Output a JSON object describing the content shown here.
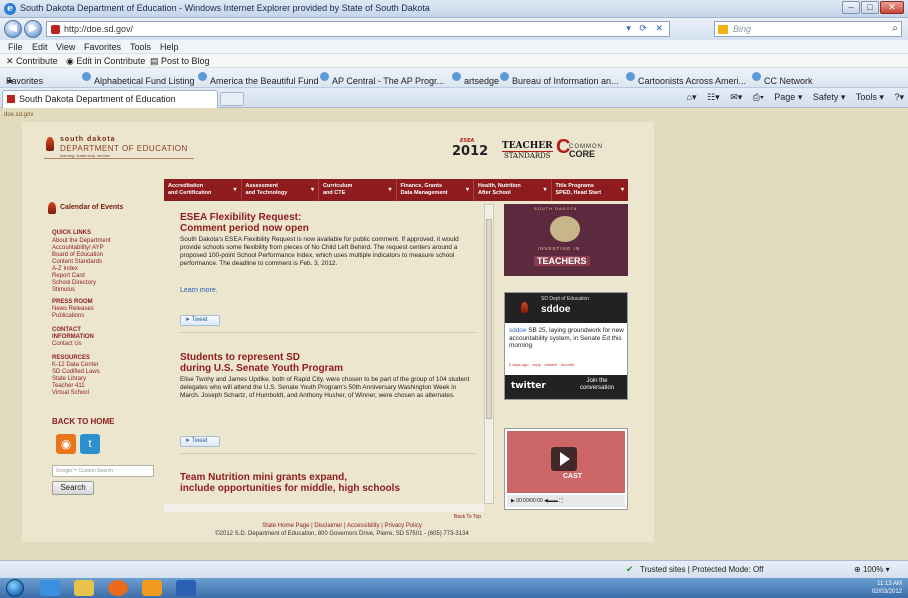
{
  "window": {
    "title": "South Dakota Department of Education - Windows Internet Explorer provided by State of South Dakota",
    "buttons": [
      "–",
      "□",
      "✕"
    ]
  },
  "address_bar": {
    "url": "http://doe.sd.gov/",
    "search_placeholder": "Bing"
  },
  "menu": [
    "File",
    "Edit",
    "View",
    "Favorites",
    "Tools",
    "Help"
  ],
  "contribute": {
    "contribute": "Contribute",
    "edit": "Edit in Contribute",
    "post": "Post to Blog"
  },
  "favorites": {
    "label": "Favorites",
    "items": [
      "Alphabetical Fund Listing",
      "America the Beautiful Fund",
      "AP Central - The AP Progr...",
      "artsedge",
      "Bureau of Information an...",
      "Cartoonists Across Ameri...",
      "CC Network"
    ]
  },
  "tab": {
    "label": "South Dakota Department of Education"
  },
  "command_bar": [
    "Page ▾",
    "Safety ▾",
    "Tools ▾"
  ],
  "page": {
    "site_tag": "doe.sd.gov",
    "logo": {
      "line1": "south dakota",
      "line2": "DEPARTMENT OF EDUCATION",
      "line3": "learning. leadership. service."
    },
    "badges": {
      "year": "2012",
      "year_small": "ESEA",
      "teacher1": "TEACHER",
      "teacher2": "STANDARDS",
      "core1": "COMMON",
      "core2": "CORE"
    },
    "nav": [
      "Accreditation\nand Certification",
      "Assessment\nand Technology",
      "Curriculum\nand CTE",
      "Finance, Grants\nData Management",
      "Health, Nutrition\nAfter School",
      "Title Programs\nSPED, Head Start"
    ],
    "left": {
      "calendar": "Calendar of Events",
      "quick_links_head": "QUICK LINKS",
      "quick_links": [
        "About the Department",
        "Accountability/ AYP",
        "Board of Education",
        "Content Standards",
        "A-Z Index",
        "Report Card",
        "School Directory",
        "Stimulus"
      ],
      "press_head": "PRESS ROOM",
      "press_links": [
        "News Releases",
        "Publications"
      ],
      "contact_head1": "CONTACT",
      "contact_head2": "INFORMATION",
      "contact_links": [
        "Contact Us"
      ],
      "resources_head": "RESOURCES",
      "resources_links": [
        "K-12 Data Center",
        "SD Codified Laws",
        "State Library",
        "Teacher 411",
        "Virtual School"
      ],
      "back_home": "BACK TO HOME",
      "search_placeholder": "Google™ Custom Search",
      "search_button": "Search"
    },
    "news": [
      {
        "title": "ESEA Flexibility Request:\nComment period now open",
        "body": "South Dakota's ESEA Flexibility Request is now available for public comment. If approved, it would provide schools some flexibility from pieces of No Child Left Behind. The request centers around a proposed 100-point School Performance Index, which uses multiple indicators to measure school performance. The deadline to comment is Feb. 3, 2012.",
        "more": "Learn more."
      },
      {
        "title": "Students to represent SD\nduring U.S. Senate Youth Program",
        "body": "Elise Twohy and James Updike, both of Rapid City, were chosen to be part of the group of 104 student delegates who will attend the U.S. Senate Youth Program's 50th Anniversary Washington Week in March. Joseph Schartz, of Humboldt, and Anthony Husher, of Winner, were chosen as alternates."
      },
      {
        "title": "Team Nutrition mini grants expand,\ninclude opportunities for middle, high schools"
      }
    ],
    "tweet_label": "Tweet",
    "back_to_top": "Back To Top",
    "right": {
      "teach_header": "SOUTH DAKOTA",
      "teach_investing": "INVESTING IN",
      "teach_teachers": "TEACHERS",
      "sddoe_name1": "SD Dept of Education",
      "sddoe_name2": "sddoe",
      "tweet_user": "sddoe",
      "tweet_text": " SB 25, laying groundwork for new accountability system, in Senate Ed this morning",
      "tweet_meta": "5 days ago · reply · retweet · favorite",
      "twitter": "twitter",
      "join": "Join the conversation",
      "video_cast": "CAST",
      "video_time": "00:00/00:00"
    },
    "footer": {
      "links": "State Home Page | Disclaimer | Accessibility | Privacy Policy",
      "copyright": "©2012 S.D. Department of Education, 800 Governors Drive, Pierre, SD 57501 - (605) 773-3134"
    }
  },
  "status": {
    "zone": "Trusted sites | Protected Mode: Off",
    "zoom": "100%"
  },
  "taskbar": {
    "time": "11:13 AM",
    "date": "02/03/2012"
  }
}
